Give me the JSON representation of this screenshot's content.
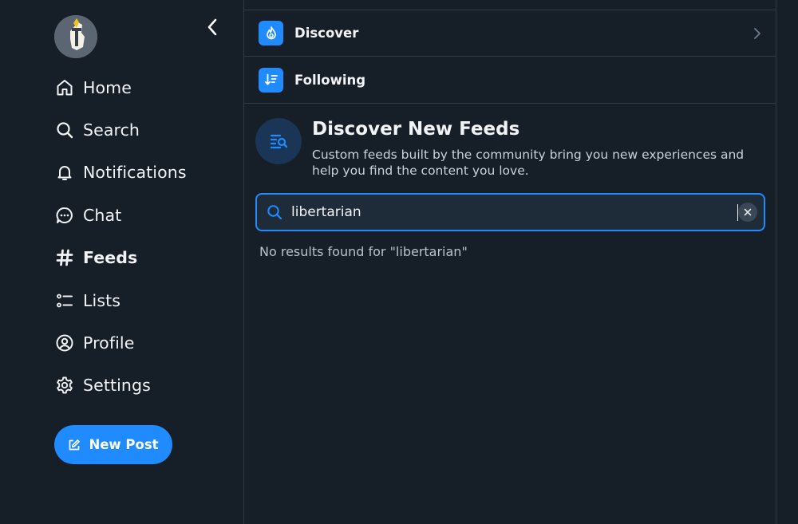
{
  "sidebar": {
    "nav": [
      {
        "label": "Home",
        "icon": "home-icon"
      },
      {
        "label": "Search",
        "icon": "search-icon"
      },
      {
        "label": "Notifications",
        "icon": "bell-icon"
      },
      {
        "label": "Chat",
        "icon": "chat-bubble-icon"
      },
      {
        "label": "Feeds",
        "icon": "hashtag-icon",
        "active": true
      },
      {
        "label": "Lists",
        "icon": "list-icon"
      },
      {
        "label": "Profile",
        "icon": "user-circle-icon"
      },
      {
        "label": "Settings",
        "icon": "gear-icon"
      }
    ],
    "new_post_label": "New Post"
  },
  "main": {
    "feeds": [
      {
        "title": "Discover",
        "icon": "flame-icon"
      },
      {
        "title": "Following",
        "icon": "sort-down-icon"
      }
    ],
    "discover": {
      "title": "Discover New Feeds",
      "description": "Custom feeds built by the community bring you new experiences and help you find the content you love."
    },
    "search": {
      "value": "libertarian",
      "no_results": "No results found for \"libertarian\""
    }
  },
  "colors": {
    "background": "#161e27",
    "accent": "#208bfe",
    "divider": "#2e3a47"
  }
}
